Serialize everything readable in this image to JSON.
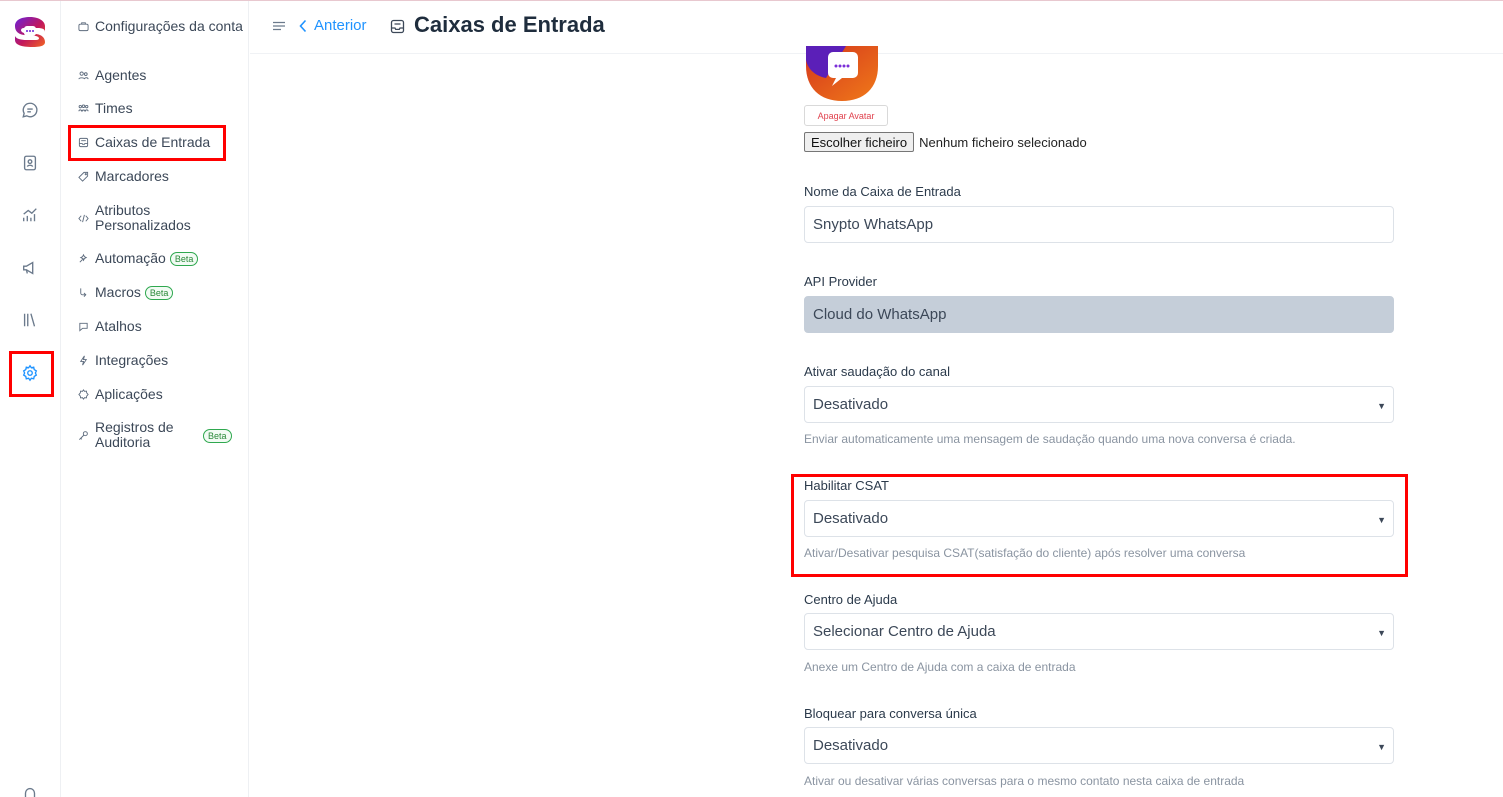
{
  "header": {
    "back_label": "Anterior",
    "title": "Caixas de Entrada"
  },
  "rail": {
    "items": [
      {
        "icon": "conversations-icon"
      },
      {
        "icon": "contacts-icon"
      },
      {
        "icon": "reports-icon"
      },
      {
        "icon": "campaigns-icon"
      },
      {
        "icon": "library-icon"
      },
      {
        "icon": "settings-icon",
        "active": true
      },
      {
        "icon": "notifications-icon"
      }
    ]
  },
  "sidebar": {
    "items": [
      {
        "label": "Configurações da conta",
        "icon": "briefcase-icon"
      },
      {
        "label": "Agentes",
        "icon": "people-icon"
      },
      {
        "label": "Times",
        "icon": "team-icon"
      },
      {
        "label": "Caixas de Entrada",
        "icon": "inbox-icon",
        "active": true
      },
      {
        "label": "Marcadores",
        "icon": "tag-icon"
      },
      {
        "label": "Atributos Personalizados",
        "icon": "code-icon"
      },
      {
        "label": "Automação",
        "icon": "automation-icon",
        "badge": "Beta"
      },
      {
        "label": "Macros",
        "icon": "macros-icon",
        "badge": "Beta"
      },
      {
        "label": "Atalhos",
        "icon": "chat-icon"
      },
      {
        "label": "Integrações",
        "icon": "lightning-icon"
      },
      {
        "label": "Aplicações",
        "icon": "apps-icon"
      },
      {
        "label": "Registros de Auditoria",
        "icon": "key-icon",
        "badge": "Beta"
      }
    ]
  },
  "form": {
    "delete_avatar_label": "Apagar Avatar",
    "file_button_label": "Escolher ficheiro",
    "file_status": "Nenhum ficheiro selecionado",
    "inbox_name": {
      "label": "Nome da Caixa de Entrada",
      "value": "Snypto WhatsApp"
    },
    "api_provider": {
      "label": "API Provider",
      "value": "Cloud do WhatsApp"
    },
    "greeting": {
      "label": "Ativar saudação do canal",
      "value": "Desativado",
      "help": "Enviar automaticamente uma mensagem de saudação quando uma nova conversa é criada."
    },
    "csat": {
      "label": "Habilitar CSAT",
      "value": "Desativado",
      "help": "Ativar/Desativar pesquisa CSAT(satisfação do cliente) após resolver uma conversa"
    },
    "help_center": {
      "label": "Centro de Ajuda",
      "value": "Selecionar Centro de Ajuda",
      "help": "Anexe um Centro de Ajuda com a caixa de entrada"
    },
    "lock_single": {
      "label": "Bloquear para conversa única",
      "value": "Desativado",
      "help": "Ativar ou desativar várias conversas para o mesmo contato nesta caixa de entrada"
    }
  },
  "colors": {
    "accent": "#1f93ff",
    "highlight": "#ff0000",
    "beta": "#2fa84f",
    "disabled_field": "#c5ced9"
  }
}
